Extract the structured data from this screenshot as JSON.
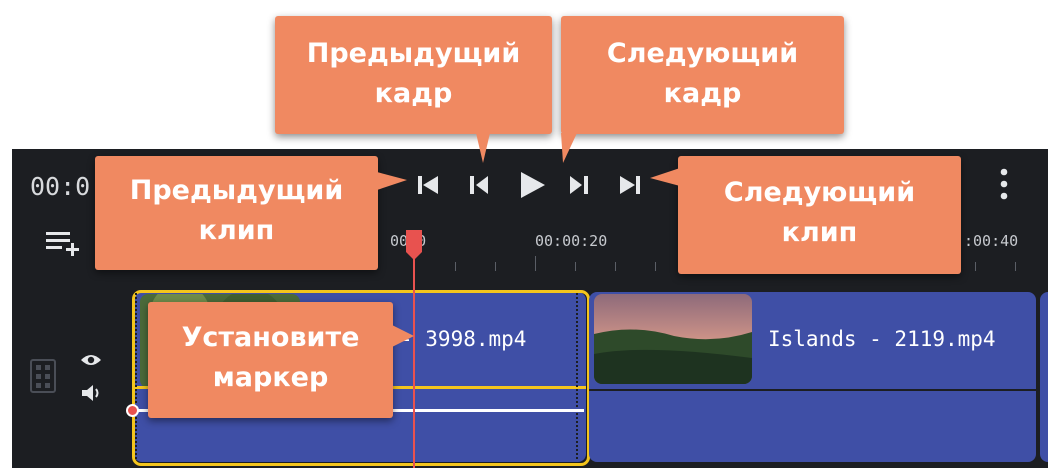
{
  "player": {
    "timecode": "00:0"
  },
  "ruler": {
    "labels": [
      "00:0",
      "00:00:20",
      ":00:40"
    ]
  },
  "clips": [
    {
      "name": "- 3998.mp4"
    },
    {
      "name": "Islands - 2119.mp4"
    }
  ],
  "callouts": {
    "prev_frame": [
      "Предыдущий",
      "кадр"
    ],
    "next_frame": [
      "Следующий",
      "кадр"
    ],
    "prev_clip": [
      "Предыдущий",
      "клип"
    ],
    "next_clip": [
      "Следующий",
      "клип"
    ],
    "set_marker": [
      "Установите",
      "маркер"
    ]
  },
  "colors": {
    "callout": "#f08961",
    "playhead": "#e8524f",
    "clip": "#3f4fa6",
    "selection": "#f4c51d"
  }
}
